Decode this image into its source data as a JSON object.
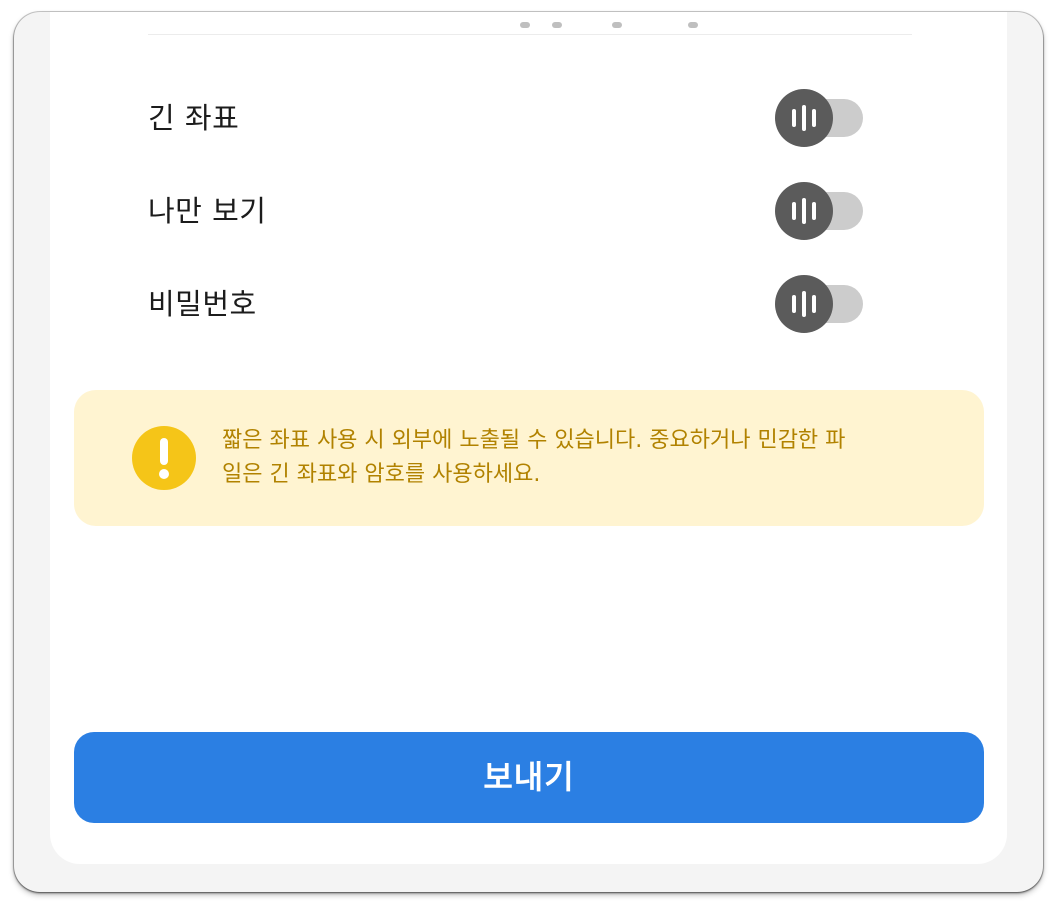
{
  "options": [
    {
      "label": "긴 좌표",
      "enabled": false
    },
    {
      "label": "나만 보기",
      "enabled": false
    },
    {
      "label": "비밀번호",
      "enabled": false
    }
  ],
  "warning": {
    "icon": "exclamation-circle-icon",
    "line1": "짧은 좌표 사용 시 외부에 노출될 수 있습니다. 중요하거나 민감한 파",
    "line2": "일은 긴 좌표와 암호를 사용하세요.",
    "color": "#b18200",
    "background": "#fff4d1"
  },
  "send_button": {
    "label": "보내기",
    "color": "#2b7fe3"
  },
  "toggle": {
    "knob_icon": "toggle-knob-bars-icon",
    "track_color": "#cccccc",
    "knob_color": "#5b5b5b"
  }
}
